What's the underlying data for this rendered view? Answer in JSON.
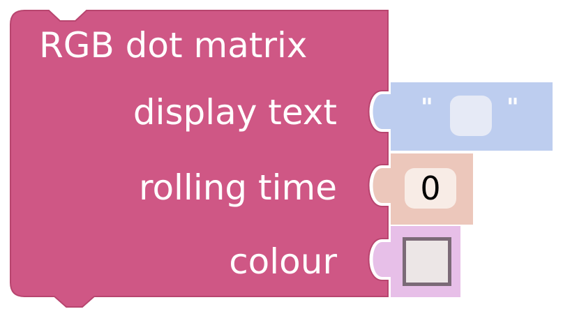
{
  "block": {
    "title": "RGB dot matrix",
    "inputs": [
      {
        "label": "display text",
        "value": ""
      },
      {
        "label": "rolling time",
        "value": "0"
      },
      {
        "label": "colour",
        "value_color": "#ece6e6"
      }
    ]
  },
  "quote_open": "\"",
  "quote_close": "\"",
  "colors": {
    "main_block": "#cf5785",
    "text_block": "#bdcdef",
    "number_block": "#ecc7bb",
    "colour_block": "#e7bfe8",
    "label": "#ffffff"
  }
}
